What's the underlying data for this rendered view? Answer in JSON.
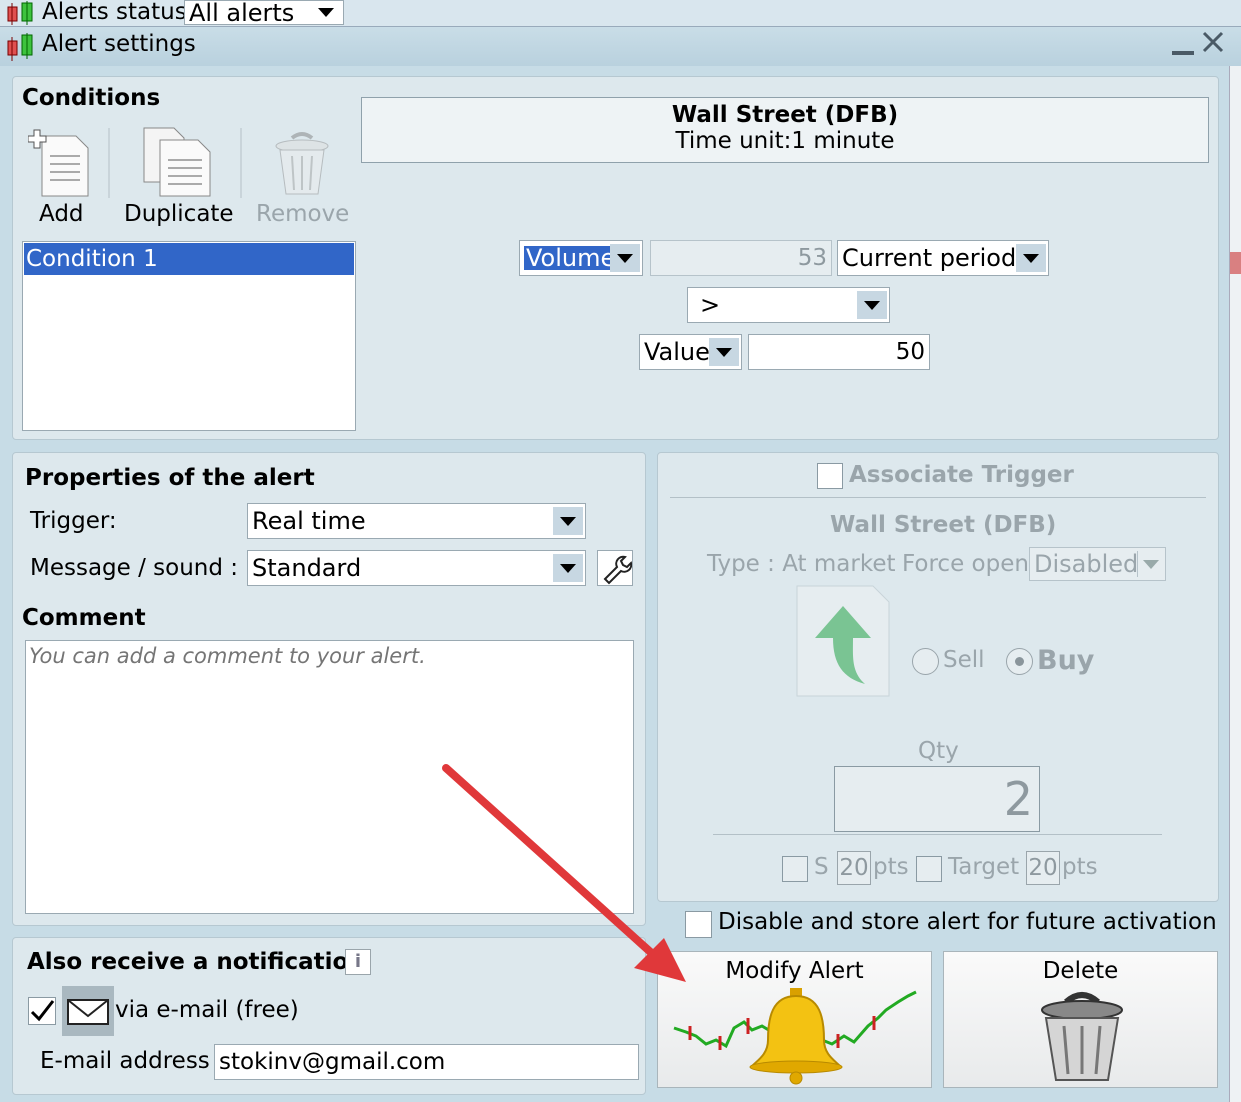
{
  "topbar": {
    "status_label": "Alerts status",
    "status_value": "All alerts"
  },
  "window": {
    "title": "Alert settings"
  },
  "conditions": {
    "heading": "Conditions",
    "add_label": "Add",
    "duplicate_label": "Duplicate",
    "remove_label": "Remove",
    "list": [
      "Condition 1"
    ],
    "instrument": "Wall Street (DFB)",
    "time_unit": "Time unit:1 minute",
    "indicator": "Volume",
    "current_value": "53",
    "period": "Current period",
    "operator": ">",
    "compare_type": "Value",
    "compare_value": "50"
  },
  "properties": {
    "heading": "Properties of the alert",
    "trigger_label": "Trigger:",
    "trigger_value": "Real time",
    "message_label": "Message / sound :",
    "message_value": "Standard",
    "comment_heading": "Comment",
    "comment_placeholder": "You can add a comment to your alert."
  },
  "trigger": {
    "associate_label": "Associate Trigger",
    "instrument": "Wall Street (DFB)",
    "type_label": "Type : At market",
    "force_open_label": "Force open",
    "force_open_value": "Disabled",
    "sell_label": "Sell",
    "buy_label": "Buy",
    "qty_label": "Qty",
    "qty_value": "2",
    "stop_label": "S",
    "stop_value": "20",
    "stop_unit": "pts",
    "target_label": "Target",
    "target_value": "20",
    "target_unit": "pts"
  },
  "disable_store_label": "Disable and store alert for future activation",
  "notification": {
    "heading": "Also receive a notification",
    "email_option": "via e-mail (free)",
    "email_label": "E-mail address",
    "email_value": "stokinv@gmail.com",
    "email_checked": true
  },
  "actions": {
    "modify_label": "Modify Alert",
    "delete_label": "Delete"
  },
  "colors": {
    "selection": "#3166c8",
    "accent_arrow": "#e0383a",
    "bell": "#f3c212"
  }
}
